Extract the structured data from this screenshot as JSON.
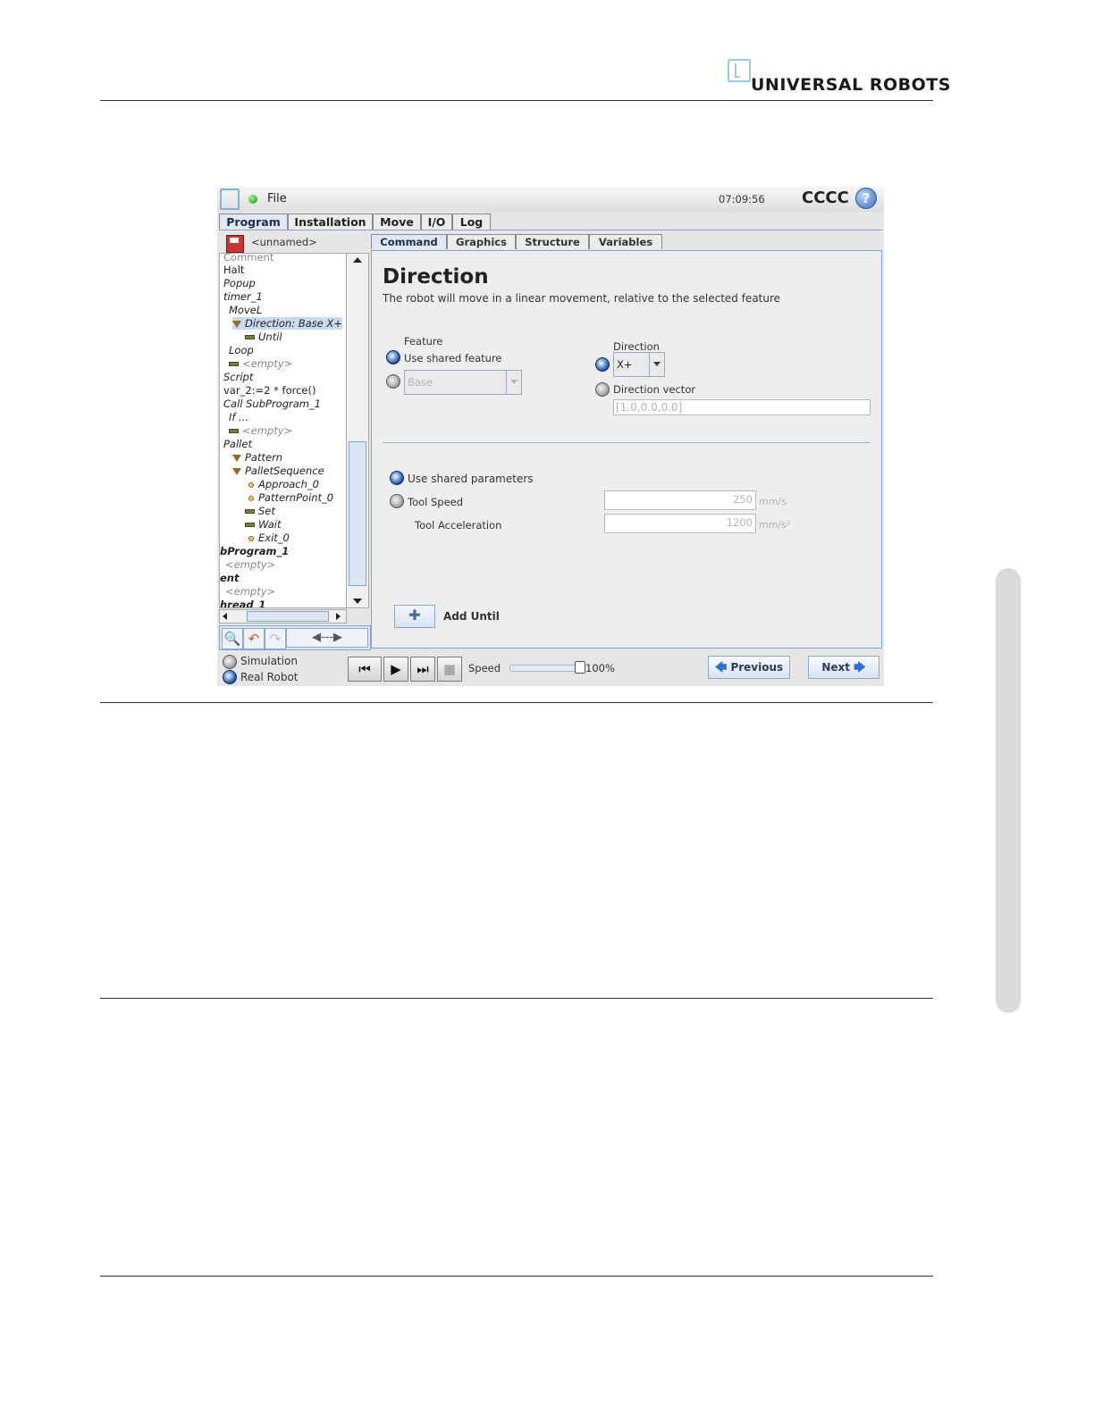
{
  "doc": {
    "brand": "UNIVERSAL ROBOTS"
  },
  "app": {
    "file_menu": "File",
    "clock": "07:09:56",
    "robot_name": "CCCC",
    "help_glyph": "?",
    "main_tabs": [
      "Program",
      "Installation",
      "Move",
      "I/O",
      "Log"
    ],
    "program_name": "<unnamed>",
    "tree": [
      {
        "label": "Comment",
        "style": "gray"
      },
      {
        "label": "Halt",
        "style": "plain"
      },
      {
        "label": "Popup",
        "style": "it"
      },
      {
        "label": "timer_1",
        "style": "it"
      },
      {
        "label": "MoveL",
        "style": "it"
      },
      {
        "label": "Direction: Base X+",
        "style": "it"
      },
      {
        "label": "Until",
        "style": "it"
      },
      {
        "label": "Loop",
        "style": "it"
      },
      {
        "label": "<empty>",
        "style": "gray"
      },
      {
        "label": "Script",
        "style": "it"
      },
      {
        "label": "var_2:=2 * force()",
        "style": "plain"
      },
      {
        "label": "Call SubProgram_1",
        "style": "it"
      },
      {
        "label": "If ...",
        "style": "it"
      },
      {
        "label": "<empty>",
        "style": "gray"
      },
      {
        "label": "Pallet",
        "style": "it"
      },
      {
        "label": "Pattern",
        "style": "it"
      },
      {
        "label": "PalletSequence",
        "style": "it"
      },
      {
        "label": "Approach_0",
        "style": "it"
      },
      {
        "label": "PatternPoint_0",
        "style": "it"
      },
      {
        "label": "Set",
        "style": "it"
      },
      {
        "label": "Wait",
        "style": "it"
      },
      {
        "label": "Exit_0",
        "style": "it"
      },
      {
        "label": "bProgram_1",
        "style": "bold"
      },
      {
        "label": "<empty>",
        "style": "gray"
      },
      {
        "label": "ent",
        "style": "bold"
      },
      {
        "label": "<empty>",
        "style": "gray"
      },
      {
        "label": "hread_1",
        "style": "bold"
      }
    ],
    "tree_move_label": "◀---▶",
    "sub_tabs": [
      "Command",
      "Graphics",
      "Structure",
      "Variables"
    ],
    "panel": {
      "title": "Direction",
      "description": "The robot will move in a linear movement, relative to the selected feature",
      "feature_label": "Feature",
      "use_shared_feature": "Use shared feature",
      "feature_select": "Base",
      "direction_label": "Direction",
      "direction_select": "X+",
      "direction_vector_label": "Direction vector",
      "direction_vector_value": "[1.0,0.0,0.0]",
      "use_shared_parameters": "Use shared parameters",
      "tool_speed_label": "Tool Speed",
      "tool_speed_value": "250",
      "tool_speed_unit": "mm/s",
      "tool_acc_label": "Tool Acceleration",
      "tool_acc_value": "1200",
      "tool_acc_unit": "mm/s²",
      "add_until_label": "Add Until"
    },
    "bottom": {
      "simulation": "Simulation",
      "real_robot": "Real Robot",
      "speed_label": "Speed",
      "speed_value": "100%",
      "speed_fraction": 1.0,
      "previous": "Previous",
      "next": "Next"
    }
  }
}
